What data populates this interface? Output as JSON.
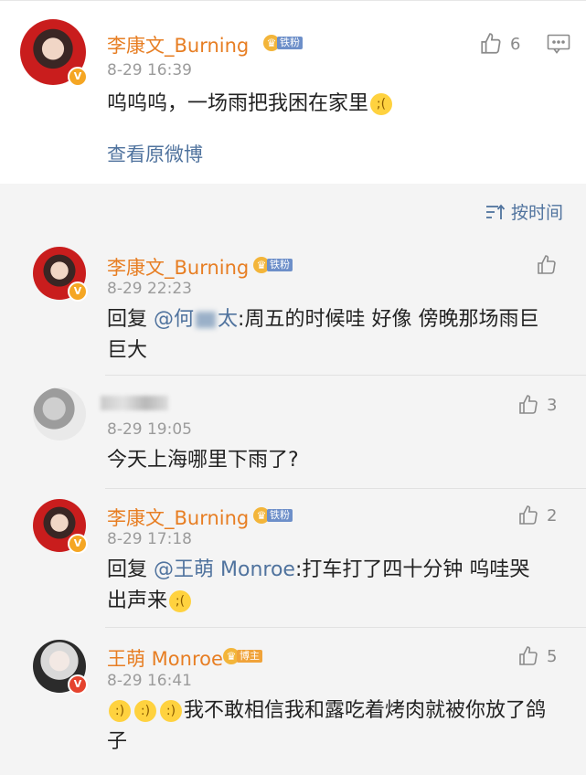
{
  "post": {
    "username": "李康文_Burning",
    "fan_badge": "铁粉",
    "time": "8-29 16:39",
    "text": "呜呜呜，一场雨把我困在家里",
    "like_count": "6",
    "view_original": "查看原微博"
  },
  "sort_label": "按时间",
  "comments": [
    {
      "username": "李康文_Burning",
      "badge": "铁粉",
      "time": "8-29 22:23",
      "reply_prefix": "回复",
      "mention_start": "@何",
      "mention_end": "太",
      "text": ":周五的时候哇 好像 傍晚那场雨巨巨大"
    },
    {
      "username": "",
      "time": "8-29 19:05",
      "text": "今天上海哪里下雨了?",
      "like_count": "3"
    },
    {
      "username": "李康文_Burning",
      "badge": "铁粉",
      "time": "8-29 17:18",
      "reply_prefix": "回复",
      "mention": "@王萌 Monroe",
      "text": ":打车打了四十分钟 呜哇哭出声来",
      "like_count": "2"
    },
    {
      "username": "王萌 Monroe",
      "badge": "博主",
      "time": "8-29 16:41",
      "text": "我不敢相信我和露吃着烤肉就被你放了鸽子",
      "like_count": "5"
    }
  ]
}
